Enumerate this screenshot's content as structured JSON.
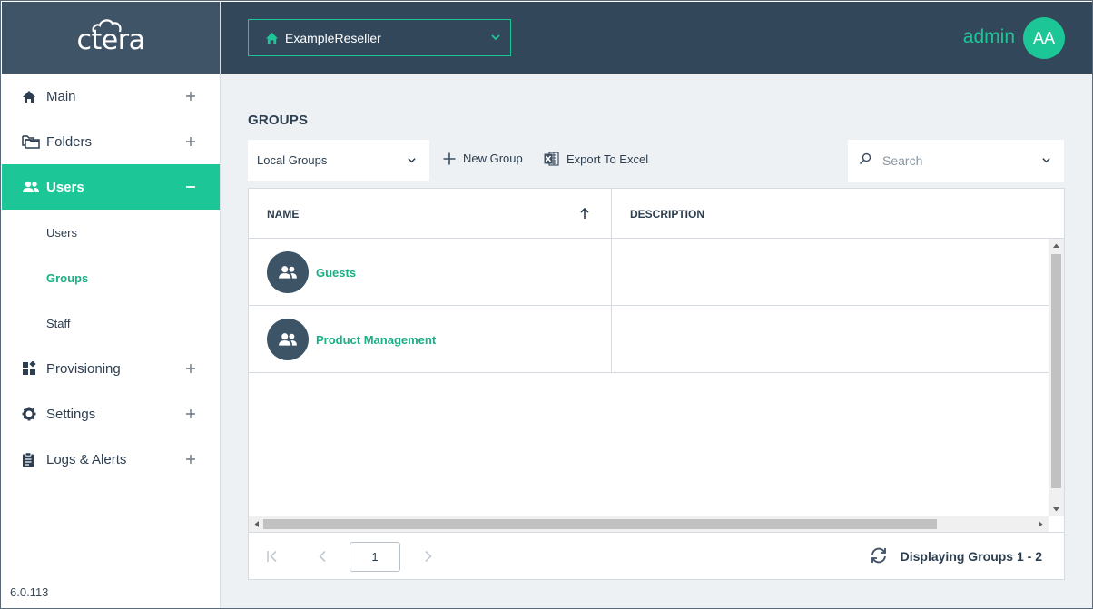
{
  "brand": {
    "logo_text": "ctera"
  },
  "sidebar": {
    "items": [
      {
        "label": "Main",
        "icon": "home-icon"
      },
      {
        "label": "Folders",
        "icon": "folders-icon"
      },
      {
        "label": "Users",
        "icon": "users-icon",
        "active": true,
        "children": [
          {
            "label": "Users"
          },
          {
            "label": "Groups",
            "selected": true
          },
          {
            "label": "Staff"
          }
        ]
      },
      {
        "label": "Provisioning",
        "icon": "provisioning-icon"
      },
      {
        "label": "Settings",
        "icon": "gear-icon"
      },
      {
        "label": "Logs & Alerts",
        "icon": "clipboard-icon"
      }
    ],
    "version": "6.0.113"
  },
  "header": {
    "tenant": "ExampleReseller",
    "user_name": "admin",
    "avatar_initials": "AA"
  },
  "page": {
    "title": "GROUPS",
    "group_type": "Local Groups",
    "new_group_label": "New Group",
    "export_label": "Export To Excel",
    "search_placeholder": "Search"
  },
  "grid": {
    "columns": [
      {
        "label": "NAME",
        "sort": "ascending"
      },
      {
        "label": "DESCRIPTION"
      }
    ],
    "rows": [
      {
        "name": "Guests",
        "description": ""
      },
      {
        "name": "Product Management",
        "description": ""
      }
    ],
    "page_number": "1",
    "displaying": "Displaying Groups 1 - 2"
  },
  "colors": {
    "accent": "#1dc696",
    "header_bg": "#33475b",
    "logo_bg": "#405468",
    "main_bg": "#eef1f4"
  }
}
